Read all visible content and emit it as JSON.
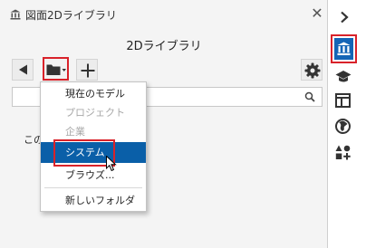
{
  "panel": {
    "title": "図面2Dライブラリ",
    "close_symbol": "✕",
    "library_title": "2Dライブラリ"
  },
  "toolbar": {
    "back_icon": "triangle-left-icon",
    "folder_icon": "folder-dropdown-icon",
    "add_icon": "plus-icon",
    "settings_icon": "gear-icon"
  },
  "search": {
    "value": "",
    "placeholder": "",
    "icon": "magnifier-icon"
  },
  "content": {
    "text": "この"
  },
  "folder_menu": {
    "items": [
      {
        "label": "現在のモデル",
        "enabled": true
      },
      {
        "label": "プロジェクト",
        "enabled": false
      },
      {
        "label": "企業",
        "enabled": false
      },
      {
        "label": "システム",
        "enabled": true,
        "selected": true
      },
      {
        "label": "ブラウズ...",
        "enabled": true
      },
      {
        "label": "新しいフォルダ",
        "enabled": true
      }
    ]
  },
  "sidebar": {
    "items": [
      {
        "icon": "chevron-right-icon"
      },
      {
        "icon": "library-icon",
        "active": true
      },
      {
        "icon": "graduation-cap-icon"
      },
      {
        "icon": "layout-icon"
      },
      {
        "icon": "globe-icon"
      },
      {
        "icon": "shapes-icon"
      }
    ]
  },
  "colors": {
    "accent": "#1565b6",
    "selection": "#0a5fa8",
    "highlight_box": "#d9222a"
  }
}
